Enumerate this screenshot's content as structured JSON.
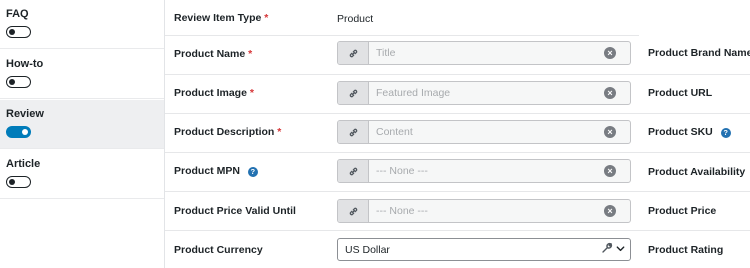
{
  "schema_types": [
    {
      "label": "FAQ",
      "enabled": false,
      "active": false
    },
    {
      "label": "How-to",
      "enabled": false,
      "active": false
    },
    {
      "label": "Review",
      "enabled": true,
      "active": true
    },
    {
      "label": "Article",
      "enabled": false,
      "active": false
    }
  ],
  "review_item_type": {
    "label": "Review Item Type",
    "required_mark": "*",
    "value": "Product"
  },
  "fields_left": [
    {
      "label": "Product Name",
      "required_mark": "*",
      "placeholder": "Title"
    },
    {
      "label": "Product Image",
      "required_mark": "*",
      "placeholder": "Featured Image"
    },
    {
      "label": "Product Description",
      "required_mark": "*",
      "placeholder": "Content"
    },
    {
      "label": "Product MPN",
      "placeholder": "--- None ---",
      "help_icon": "?"
    },
    {
      "label": "Product Price Valid Until",
      "placeholder": "--- None ---"
    }
  ],
  "currency": {
    "label": "Product Currency",
    "value": "US Dollar"
  },
  "fields_right": [
    {
      "label": "Product Brand Name"
    },
    {
      "label": "Product URL"
    },
    {
      "label": "Product SKU",
      "help_icon": "?"
    },
    {
      "label": "Product Availability"
    },
    {
      "label": "Product Price"
    },
    {
      "label": "Product Rating"
    }
  ],
  "icons": {
    "clear": "×",
    "link": "link-icon",
    "wrench": "wrench-icon",
    "chevron": "chevron-down-icon"
  },
  "colors": {
    "accent": "#007cba",
    "required": "#d63638",
    "help": "#2271b1"
  }
}
